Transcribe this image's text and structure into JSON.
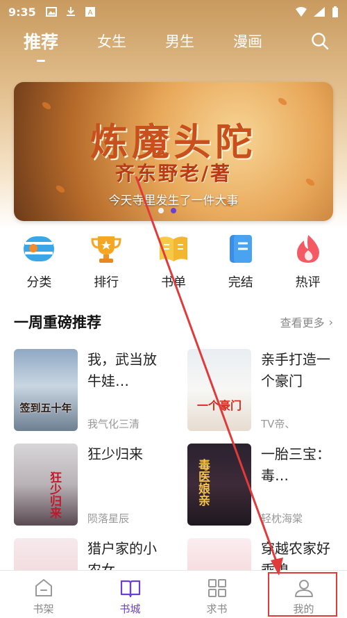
{
  "status_bar": {
    "time": "9:35"
  },
  "top_nav": {
    "tabs": [
      {
        "label": "推荐"
      },
      {
        "label": "女生"
      },
      {
        "label": "男生"
      },
      {
        "label": "漫画"
      }
    ]
  },
  "banner": {
    "title": "炼魔头陀",
    "author": "齐东野老/著",
    "subtitle": "今天寺里发生了一件大事"
  },
  "categories": [
    {
      "label": "分类",
      "icon": "category-icon"
    },
    {
      "label": "排行",
      "icon": "trophy-icon"
    },
    {
      "label": "书单",
      "icon": "book-list-icon"
    },
    {
      "label": "完结",
      "icon": "finished-icon"
    },
    {
      "label": "热评",
      "icon": "hot-comment-icon"
    }
  ],
  "section": {
    "title": "一周重磅推荐",
    "more": "查看更多"
  },
  "books": [
    {
      "title": "我，武当放牛娃…",
      "author": "我气化三清",
      "cover_text": "签到五十年"
    },
    {
      "title": "亲手打造一个豪门",
      "author": "TV帝、",
      "cover_text": "一个豪门"
    },
    {
      "title": "狂少归来",
      "author": "陨落星辰",
      "cover_text": "狂少归来"
    },
    {
      "title": "一胎三宝：毒…",
      "author": "轻枕海棠",
      "cover_text": "毒医娘亲"
    },
    {
      "title": "猎户家的小农女",
      "author": "",
      "cover_text": ""
    },
    {
      "title": "穿越农家好乖媳",
      "author": "",
      "cover_text": ""
    }
  ],
  "bottom_nav": [
    {
      "label": "书架",
      "icon": "bookshelf-icon"
    },
    {
      "label": "书城",
      "icon": "bookstore-icon"
    },
    {
      "label": "求书",
      "icon": "request-book-icon"
    },
    {
      "label": "我的",
      "icon": "profile-icon"
    }
  ],
  "colors": {
    "accent": "#6a3fd6",
    "highlight": "#e03a3a"
  }
}
